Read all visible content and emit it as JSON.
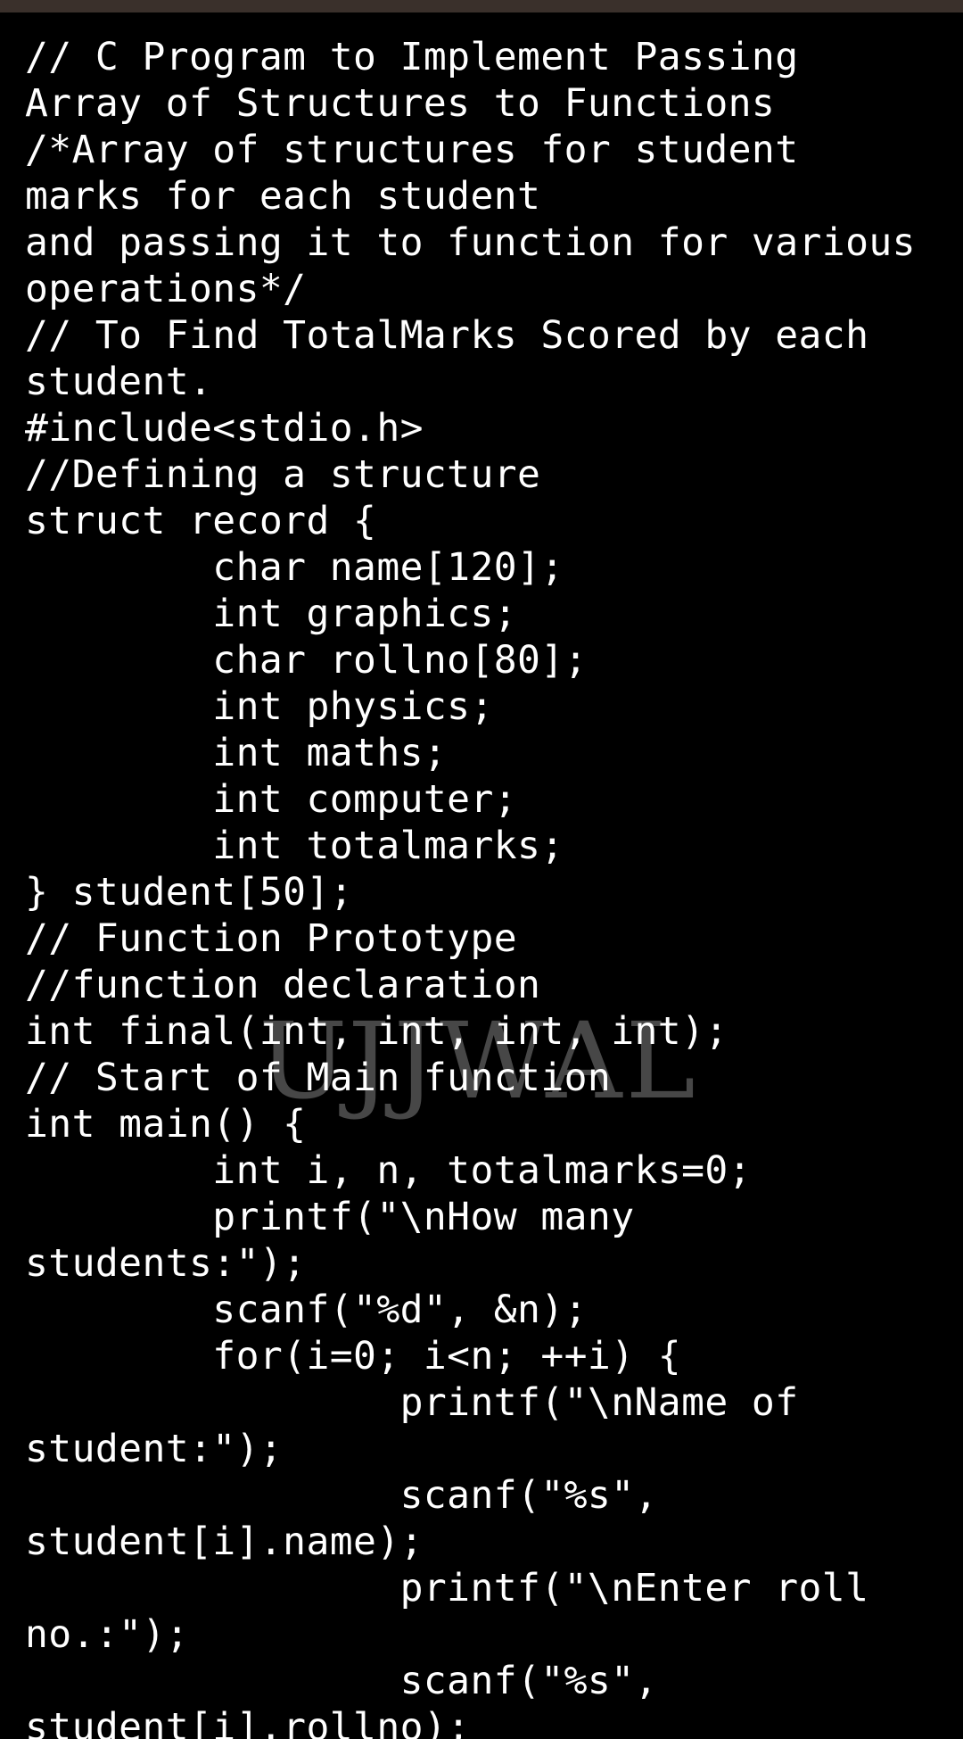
{
  "editor": {
    "lines": [
      "// C Program to Implement Passing",
      "Array of Structures to Functions",
      "/*Array of structures for student",
      "marks for each student",
      "and passing it to function for various",
      "operations*/",
      "// To Find TotalMarks Scored by each",
      "student.",
      "#include<stdio.h>",
      "//Defining a structure",
      "struct record {",
      "        char name[120];",
      "        int graphics;",
      "        char rollno[80];",
      "        int physics;",
      "        int maths;",
      "        int computer;",
      "        int totalmarks;",
      "} student[50];",
      "// Function Prototype",
      "//function declaration",
      "int final(int, int, int, int);",
      "// Start of Main function",
      "int main() {",
      "        int i, n, totalmarks=0;",
      "        printf(\"\\nHow many",
      "students:\");",
      "        scanf(\"%d\", &n);",
      "        for(i=0; i<n; ++i) {",
      "                printf(\"\\nName of",
      "student:\");",
      "                scanf(\"%s\",",
      "student[i].name);",
      "                printf(\"\\nEnter roll",
      "no.:\");",
      "                scanf(\"%s\",",
      "student[i].rollno);"
    ]
  },
  "watermark": {
    "text": "UJJWAL"
  },
  "colors": {
    "background": "#000000",
    "text": "#ffffff",
    "top_bar": "#3a302b"
  }
}
